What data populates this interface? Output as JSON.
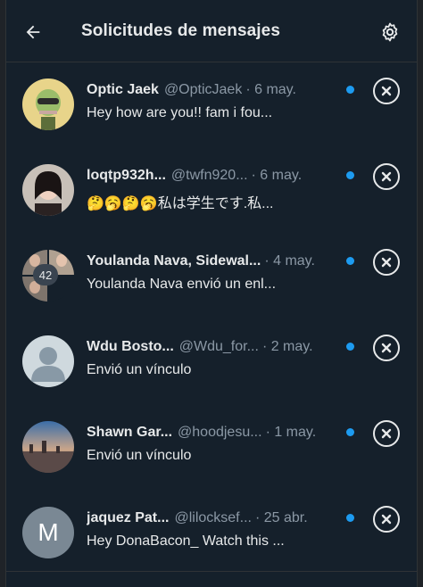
{
  "header": {
    "title": "Solicitudes de mensajes",
    "back_icon": "arrow-left-icon",
    "settings_icon": "gear-icon"
  },
  "colors": {
    "background": "#15202b",
    "text": "#e7e9ea",
    "muted": "#8b98a5",
    "accent": "#1d9bf0"
  },
  "requests": [
    {
      "name": "Optic Jaek",
      "handle": "@OpticJaek",
      "date": "· 6 may.",
      "preview": "Hey how are you!! fam i fou...",
      "unread": true
    },
    {
      "name": "loqtp932h...",
      "handle": "@twfn920...",
      "date": "· 6 may.",
      "preview": "🤔🥱🤔🥱私は学生です.私...",
      "unread": true
    },
    {
      "name": "Youlanda Nava, Sidewal...",
      "handle": "",
      "date": "· 4 may.",
      "preview": "Youlanda Nava envió un enl...",
      "unread": true,
      "group_count": "42"
    },
    {
      "name": "Wdu Bosto...",
      "handle": "@Wdu_for...",
      "date": "· 2 may.",
      "preview": "Envió un vínculo",
      "unread": true
    },
    {
      "name": "Shawn Gar...",
      "handle": "@hoodjesu...",
      "date": "· 1 may.",
      "preview": "Envió un vínculo",
      "unread": true
    },
    {
      "name": "jaquez Pat...",
      "handle": "@lilocksef...",
      "date": "· 25 abr.",
      "preview": "Hey DonaBacon_ Watch this ...",
      "unread": true,
      "avatar_letter": "M"
    }
  ]
}
